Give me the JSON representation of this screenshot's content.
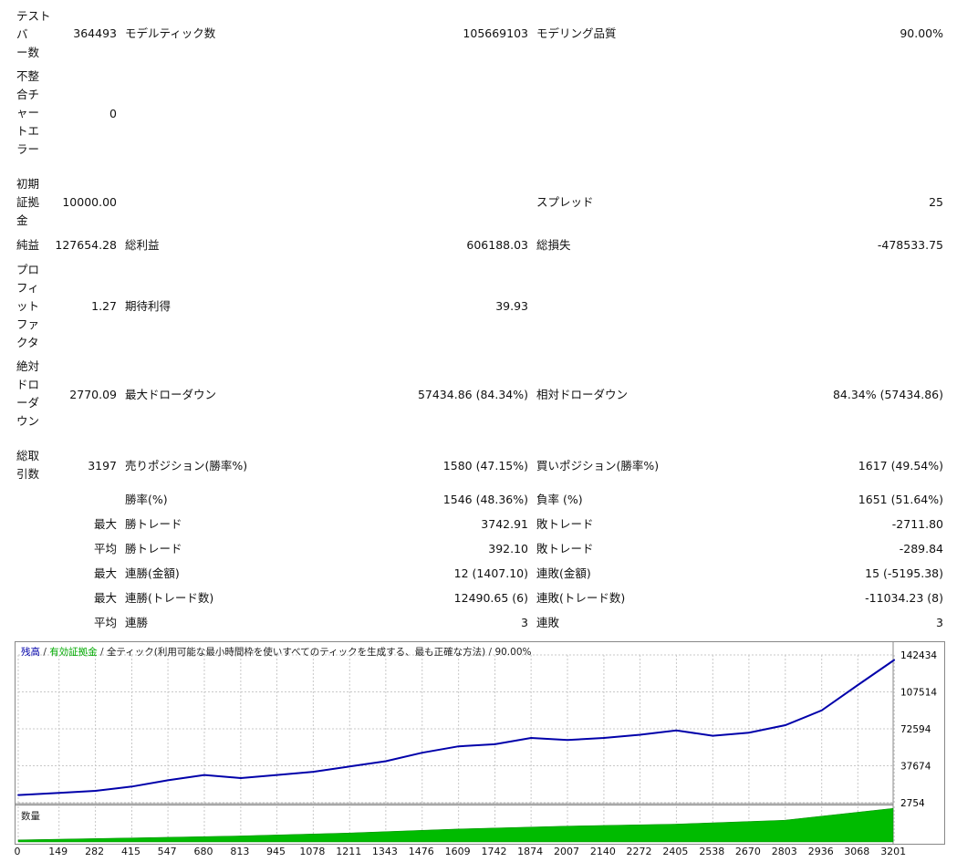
{
  "report": {
    "bars": {
      "label": [
        "テスト",
        "バ",
        "ー数"
      ],
      "value": "364493"
    },
    "ticks": {
      "label": "モデルティック数",
      "value": "105669103"
    },
    "quality": {
      "label": "モデリング品質",
      "value": "90.00%"
    },
    "mismatch": {
      "label": [
        "不整",
        "合チ",
        "ャー",
        "トエ",
        "ラー"
      ],
      "value": "0"
    },
    "deposit": {
      "label": [
        "初期",
        "証拠",
        "金"
      ],
      "value": "10000.00"
    },
    "spread": {
      "label": "スプレッド",
      "value": "25"
    },
    "net_profit": {
      "label": "純益",
      "value": "127654.28"
    },
    "gross_profit": {
      "label": "総利益",
      "value": "606188.03"
    },
    "gross_loss": {
      "label": "総損失",
      "value": "-478533.75"
    },
    "profit_factor": {
      "label": [
        "プロ",
        "フィ",
        "ット",
        "ファ",
        "クタ"
      ],
      "value": "1.27"
    },
    "expected": {
      "label": "期待利得",
      "value": "39.93"
    },
    "abs_dd": {
      "label": [
        "絶対",
        "ドロ",
        "ーダ",
        "ウン"
      ],
      "value": "2770.09"
    },
    "max_dd": {
      "label": "最大ドローダウン",
      "value": "57434.86 (84.34%)"
    },
    "rel_dd": {
      "label": "相対ドローダウン",
      "value": "84.34% (57434.86)"
    },
    "total_trades": {
      "label": [
        "総取",
        "引数"
      ],
      "value": "3197"
    },
    "short_pos": {
      "label": "売りポジション(勝率%)",
      "value": "1580 (47.15%)"
    },
    "long_pos": {
      "label": "買いポジション(勝率%)",
      "value": "1617 (49.54%)"
    },
    "win_rate": {
      "label": "勝率(%)",
      "value": "1546 (48.36%)"
    },
    "loss_rate": {
      "label": "負率 (%)",
      "value": "1651 (51.64%)"
    },
    "max_trade": {
      "prefix": "最大",
      "win_label": "勝トレード",
      "win_value": "3742.91",
      "loss_label": "敗トレード",
      "loss_value": "-2711.80"
    },
    "avg_trade": {
      "prefix": "平均",
      "win_label": "勝トレード",
      "win_value": "392.10",
      "loss_label": "敗トレード",
      "loss_value": "-289.84"
    },
    "max_consec_amount": {
      "prefix": "最大",
      "win_label": "連勝(金額)",
      "win_value": "12 (1407.10)",
      "loss_label": "連敗(金額)",
      "loss_value": "15 (-5195.38)"
    },
    "max_consec_trades": {
      "prefix": "最大",
      "win_label": "連勝(トレード数)",
      "win_value": "12490.65 (6)",
      "loss_label": "連敗(トレード数)",
      "loss_value": "-11034.23 (8)"
    },
    "avg_consec": {
      "prefix": "平均",
      "win_label": "連勝",
      "win_value": "3",
      "loss_label": "連敗",
      "loss_value": "3"
    }
  },
  "chart": {
    "legend": {
      "balance": "残高",
      "sep1": " / ",
      "equity": "有効証拠金",
      "sep2": " / ",
      "model": "全ティック(利用可能な最小時間枠を使いすべてのティックを生成する、最も正確な方法)",
      "sep3": " / ",
      "quality": "90.00%"
    },
    "volume_label": "数量",
    "colors": {
      "balance": "#0000aa",
      "equity": "#00aa00",
      "volume": "#00bb00",
      "grid": "#c8c8c8"
    }
  },
  "chart_data": {
    "type": "line",
    "title": "",
    "x_ticks": [
      "0",
      "149",
      "282",
      "415",
      "547",
      "680",
      "813",
      "945",
      "1078",
      "1211",
      "1343",
      "1476",
      "1609",
      "1742",
      "1874",
      "2007",
      "2140",
      "2272",
      "2405",
      "2538",
      "2670",
      "2803",
      "2936",
      "3068",
      "3201"
    ],
    "y_ticks": [
      "142434",
      "107514",
      "72594",
      "37674",
      "2754"
    ],
    "x_range": [
      0,
      3197
    ],
    "y_range": [
      2754,
      142434
    ],
    "series": [
      {
        "name": "残高",
        "x": [
          0,
          149,
          282,
          415,
          547,
          680,
          813,
          945,
          1078,
          1211,
          1343,
          1476,
          1609,
          1742,
          1874,
          2007,
          2140,
          2272,
          2405,
          2538,
          2670,
          2803,
          2936,
          3068,
          3201
        ],
        "y": [
          10000,
          12000,
          14000,
          18000,
          24000,
          29000,
          26000,
          29000,
          32000,
          37000,
          42000,
          50000,
          56000,
          58000,
          64000,
          62000,
          64000,
          67000,
          71000,
          66000,
          69000,
          76000,
          90000,
          114000,
          137654
        ]
      }
    ],
    "volume": {
      "x": [
        0,
        400,
        800,
        1200,
        1600,
        2000,
        2400,
        2800,
        3197
      ],
      "y": [
        2,
        4,
        6,
        9,
        13,
        16,
        18,
        22,
        34
      ]
    }
  }
}
